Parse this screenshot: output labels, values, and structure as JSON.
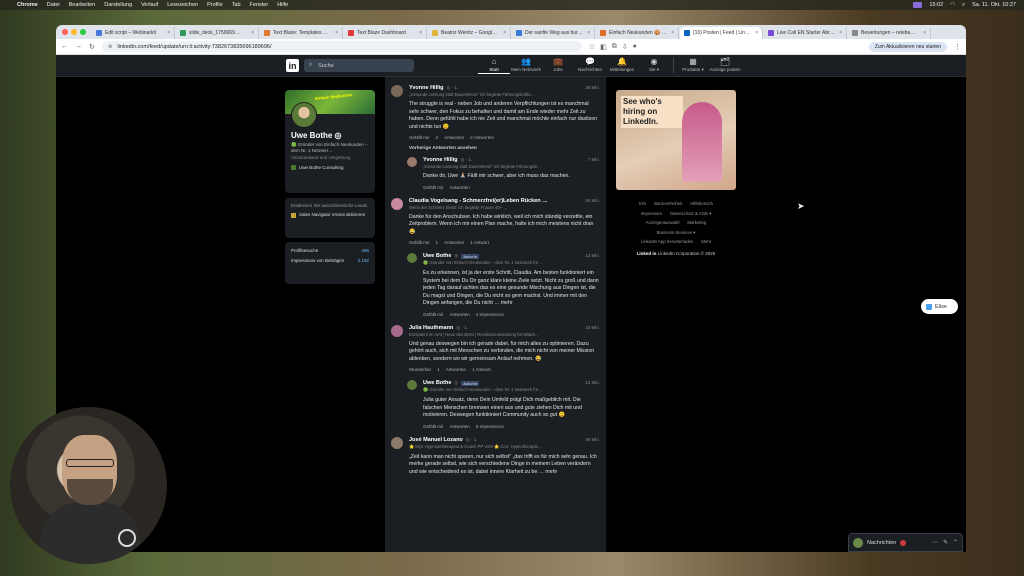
{
  "menubar": {
    "items": [
      "Chrome",
      "Datei",
      "Bearbeiten",
      "Darstellung",
      "Verlauf",
      "Lesezeichen",
      "Profile",
      "Tab",
      "Fenster",
      "Hilfe"
    ],
    "time": "15:02",
    "datetime": "Sa. 11. Okt. 10:27"
  },
  "tabs": [
    {
      "label": "Edit script – Webinarkit",
      "color": "#4a7ad8"
    },
    {
      "label": "slide_deck_1759669…",
      "color": "#2f9a5a"
    },
    {
      "label": "Text Blaze: Templates …",
      "color": "#e07a2a"
    },
    {
      "label": "Text Blaze Dashboard",
      "color": "#e03a3a"
    },
    {
      "label": "Beatriz Weintz – Googl…",
      "color": "#e0b63a"
    },
    {
      "label": "Der sanfte Weg aus bur…",
      "color": "#3a7ad8"
    },
    {
      "label": "Einfach Neukunden 🍪 …",
      "color": "#e06a2a"
    },
    {
      "label": "(10) Posten | Feed | Lin…",
      "color": "#0a66c2"
    },
    {
      "label": "Live Call EN Starter Abr…",
      "color": "#7a4ad8"
    },
    {
      "label": "Bewertungen – reteba…",
      "color": "#888888"
    }
  ],
  "omnibar": {
    "url": "linkedin.com/feed/update/urn:li:activity:7382673835696189696/",
    "update_label": "Zum Aktualisieren neu starten"
  },
  "linkedin": {
    "search_placeholder": "Suche",
    "nav": [
      {
        "icon": "⌂",
        "label": "Start"
      },
      {
        "icon": "👥",
        "label": "Mein Netzwerk"
      },
      {
        "icon": "💼",
        "label": "Jobs"
      },
      {
        "icon": "💬",
        "label": "Nachrichten"
      },
      {
        "icon": "🔔",
        "label": "Mitteilungen"
      },
      {
        "icon": "◉",
        "label": "Sie ▾"
      },
      {
        "icon": "▦",
        "label": "Produkte ▾"
      },
      {
        "icon": "🗂",
        "label": "Anzeige posten"
      }
    ]
  },
  "profile": {
    "cover_text": "Einfach Neukunden",
    "name": "Uwe Bothe ◎",
    "headline": "🟢 Gründer von Einfach-Neukunden – dem Nr. 1 Netzwer…",
    "location": "Alcantaraland und Umgebung",
    "company": "Uwe Bothe Consulting"
  },
  "premium": {
    "text": "Entdecken Sie ausschliessliche Leads",
    "link": "Sales Navigator erneut aktivieren"
  },
  "stats": [
    {
      "label": "Profilbesuche",
      "value": "496"
    },
    {
      "label": "Impressions von Beiträgen",
      "value": "2.192"
    }
  ],
  "comments": [
    {
      "name": "Yvonne Hillig",
      "deg": "◎ · 1.",
      "time": "28 Min.",
      "sub": "„Gesunde Leistung statt Dauerstress\" Ich begleite Führungskräfte…",
      "text": "The struggle is real - neben Job und anderen Verpflichtungen ist es manchmal sehr schwer, den Fokus zu behalten und damit am Ende wieder mehr Zeit zu haben. Denn gefühlt habe ich nie Zeit und manchmal möchte einfach nur dasitzen und nichts tun 😊",
      "actions": [
        "Gefällt mir",
        "2",
        "Antworten",
        "2 Antworten"
      ]
    },
    {
      "name": "Yvonne Hillig",
      "deg": "◎ · 1.",
      "time": "7 Min.",
      "sub": "„Gesunde Leistung statt Dauerstress\" Ich begleite Führungskr…",
      "text": "Danke dir, Uwe 🙏🏼 Fällt mir schwer, aber ich muss das machen.",
      "actions": [
        "Gefällt mir",
        "Antworten"
      ],
      "reply": true
    },
    {
      "name": "Claudia Vogelsang - Schmerzfrei(er)Leben Rücken …",
      "deg": "",
      "time": "26 Min.",
      "sub": "Wenn der Schmerz bleibt: ich begleite Frauen 40+ …",
      "text": "Danke für den Anschubser. Ich habe wirklich, weil ich mich ständig verzettle, ein Zeitproblem. Wenn ich mir einen Plan mache, halte ich mich meistens nicht dran😂",
      "actions": [
        "Gefällt mir",
        "1",
        "Antworten",
        "1 Antwort"
      ]
    },
    {
      "name": "Uwe Bothe",
      "deg": "◎",
      "badge": "Autor:in",
      "time": "13 Min.",
      "sub": "🟢 Gründer von Einfach-Neukunden – dem Nr. 1 Netzwerk für…",
      "text": "Es zu erkennen, ist ja der erste Schritt, Claudia. Am besten funktioniert ein System bei dem Du Dir ganz klare kleine Ziele setzt. Nicht zu groß und dann jeden Tag darauf achten das es eine gesunde Mischung aus Dingen ist, die Du magst und Dingen, die Du nicht so gern machst. Und immer mit den Dingen anfangen, die Du nicht … mehr",
      "actions": [
        "Gefällt mir",
        "Antworten",
        "4 Impressions"
      ],
      "reply": true
    },
    {
      "name": "Julia Hauthmann",
      "deg": "◎ · 1.",
      "time": "18 Min.",
      "sub": "Entspannt im Amt | Neue des BGM | Resilienzentwicklung für Mitarb…",
      "text": "Und genau deswegen bin ich gerade dabei, für mich alles zu optimieren. Dazu gehört auch, sich mit Menschen zu verbinden, die mich nicht von meiner Mission ablenken, sondern wo wir gemeinsam Anlauf nehmen. 😂",
      "actions": [
        "Wunderbar",
        "1",
        "Antworten",
        "1 Antwort"
      ]
    },
    {
      "name": "Uwe Bothe",
      "deg": "◎",
      "badge": "Autor:in",
      "time": "12 Min.",
      "sub": "🟢 Gründer von Einfach-Neukunden – dem Nr. 1 Netzwerk für…",
      "text": "Julia guter Ansatz, denn Dein Umfeld prägt Dich maßgeblich mit. Die falschen Menschen bremsen einen aus und gute ziehen Dich mit und motivieren. Deswegen funktioniert Community auch so gut 😊",
      "actions": [
        "Gefällt mir",
        "Antworten",
        "6 Impressions"
      ],
      "reply": true
    },
    {
      "name": "José Manuel Lozano",
      "deg": "◎ · 1.",
      "time": "48 Min.",
      "sub": "🌟 Dipl. Hypnosetherapeut & Coach PP VSN 🌟 Cert. Hypnotherapis…",
      "text": "„Zeit kann man nicht sparen, nur sich selbst\" „das trifft es für mich sehr genau. Ich merke gerade selbst, wie sich verschiedene Dinge in meinem Leben verändern und wie entscheidend es ist, dabei innere Klarheit zu be … mehr",
      "actions": []
    }
  ],
  "prev_answers": "Vorherige Antworten ansehen",
  "ad": {
    "title": "See who's hiring on LinkedIn."
  },
  "footer": {
    "links": [
      "Info",
      "Barrierefreiheit",
      "Hilfebereich",
      "Impressum",
      "Datenschutz & AGB ▾",
      "Anzeigenauswahl",
      "Marketing",
      "Business-Services ▾",
      "LinkedIn App herunterladen",
      "Mehr"
    ],
    "copy": "LinkedIn Corporation © 2025",
    "brand": "Linked in"
  },
  "elise": {
    "label": "Elise"
  },
  "messages": {
    "label": "Nachrichten"
  }
}
